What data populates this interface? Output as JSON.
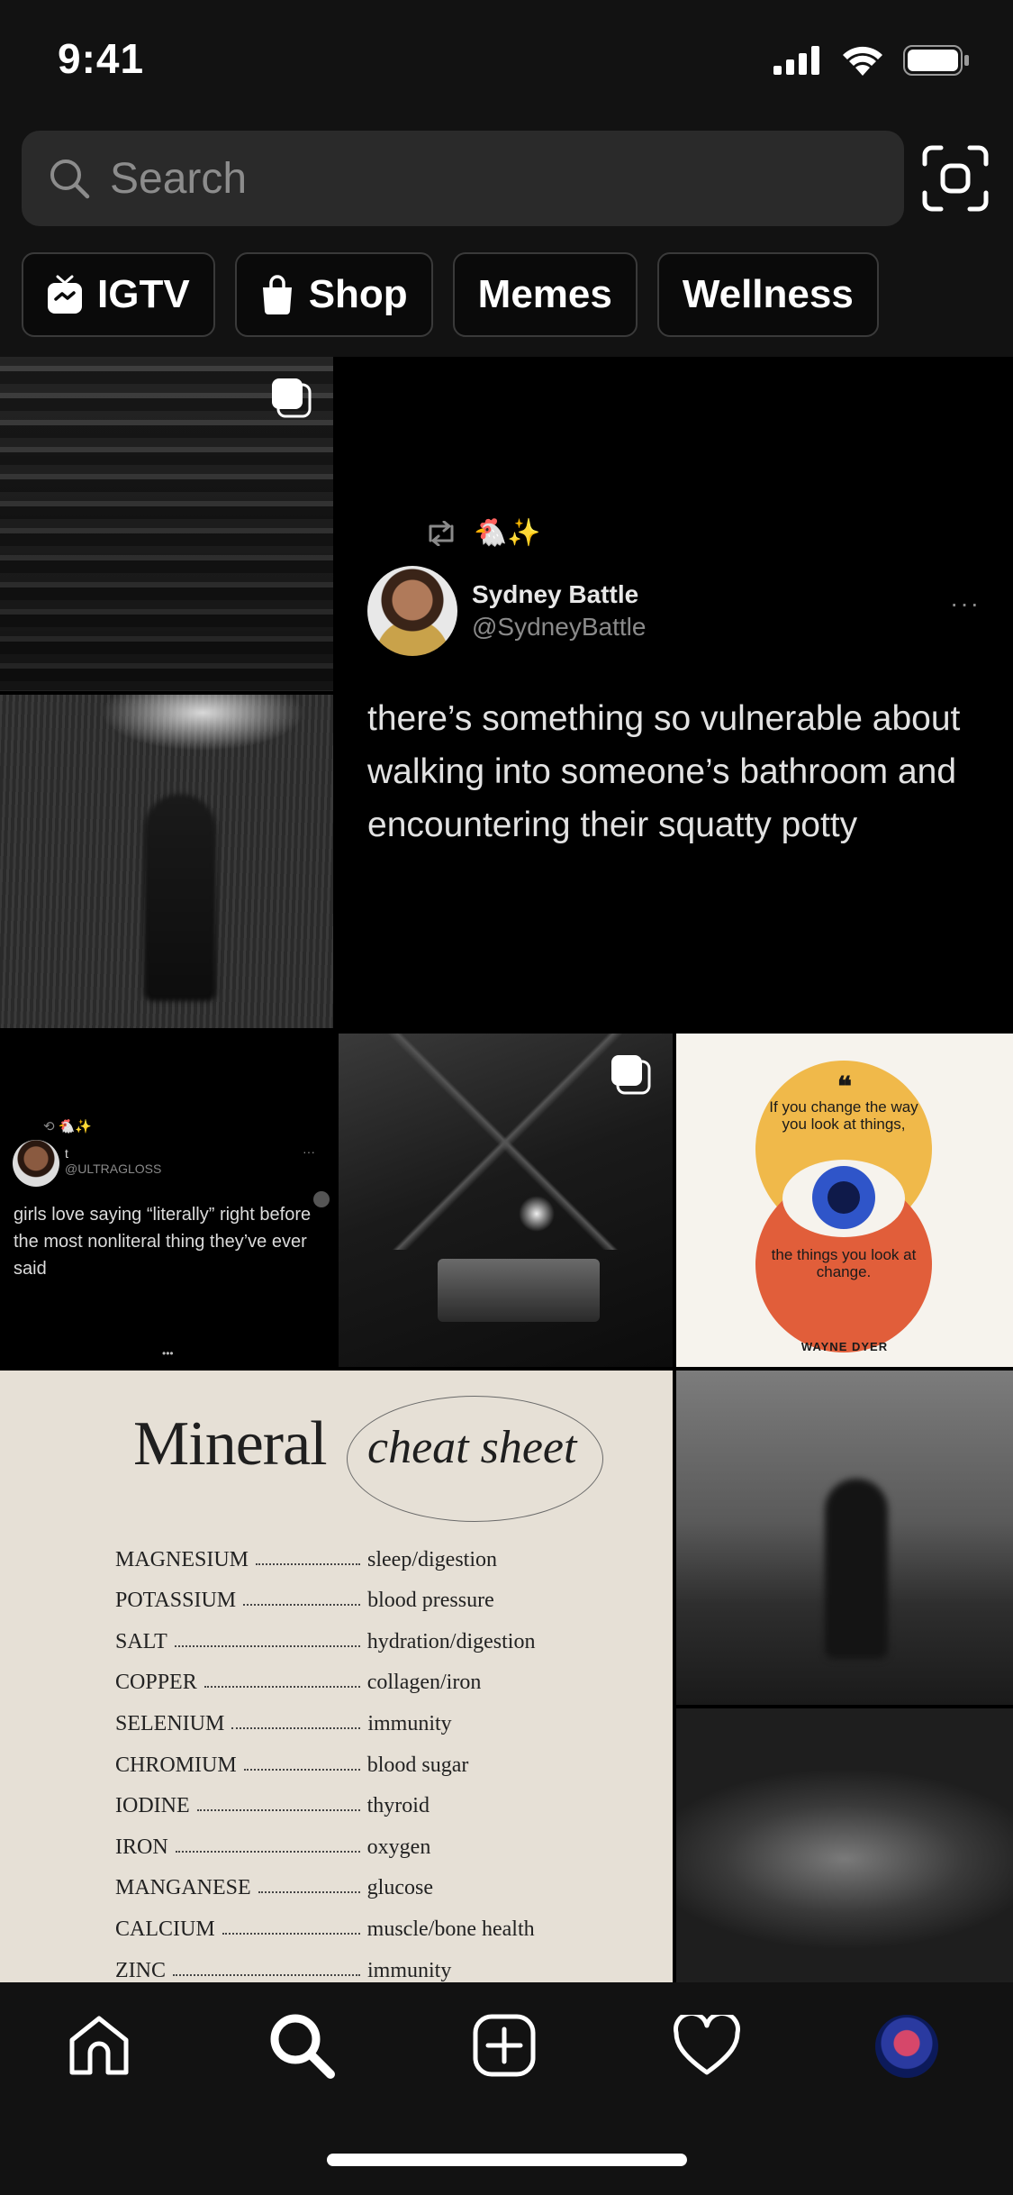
{
  "status_bar": {
    "time": "9:41"
  },
  "search": {
    "placeholder": "Search"
  },
  "chips": [
    {
      "label": "IGTV",
      "icon": "igtv-icon"
    },
    {
      "label": "Shop",
      "icon": "shopping-bag-icon"
    },
    {
      "label": "Memes"
    },
    {
      "label": "Wellness"
    }
  ],
  "tweet_large": {
    "emoji": "🐔✨",
    "name": "Sydney Battle",
    "handle": "@SydneyBattle",
    "more": "···",
    "body": "there’s something so vulnerable about walking into someone’s bathroom and encountering their squatty potty"
  },
  "tweet_small": {
    "emoji": "🐔✨",
    "name": "t",
    "handle": "@ULTRAGLOSS",
    "more": "···",
    "body": "girls love saying “literally” right before the most nonliteral thing they’ve ever said",
    "pager": "•••"
  },
  "quote_card": {
    "mark": "❝",
    "line1": "If you change the way you look at things,",
    "line2": "the things you look at change.",
    "author": "WAYNE DYER",
    "colors": {
      "top": "#f0b94a",
      "bottom": "#e15e3a",
      "eye": "#2f55c9"
    }
  },
  "mineral": {
    "title": "Mineral",
    "subtitle": "cheat sheet",
    "rows": [
      {
        "k": "MAGNESIUM",
        "v": "sleep/digestion"
      },
      {
        "k": "POTASSIUM",
        "v": "blood pressure"
      },
      {
        "k": "SALT",
        "v": "hydration/digestion"
      },
      {
        "k": "COPPER",
        "v": "collagen/iron"
      },
      {
        "k": "SELENIUM",
        "v": "immunity"
      },
      {
        "k": "CHROMIUM",
        "v": "blood sugar"
      },
      {
        "k": "IODINE",
        "v": "thyroid"
      },
      {
        "k": "IRON",
        "v": "oxygen"
      },
      {
        "k": "MANGANESE",
        "v": "glucose"
      },
      {
        "k": "CALCIUM",
        "v": "muscle/bone health"
      },
      {
        "k": "ZINC",
        "v": "immunity"
      }
    ]
  },
  "bottom_nav": {
    "items": [
      "home-icon",
      "search-icon",
      "new-post-icon",
      "heart-icon",
      "profile-avatar"
    ]
  }
}
